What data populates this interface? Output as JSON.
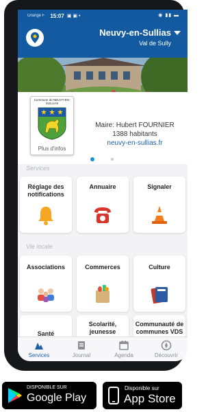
{
  "status": {
    "carrier": "Orange F",
    "time": "15:07",
    "icons": "▣ ▣ •",
    "right": "◉ ▮▮ ▬"
  },
  "header": {
    "title": "Neuvy-en-Sullias",
    "subtitle": "Val de Sully"
  },
  "crest": {
    "name": "Commune de NEUVY-EN-SULLIAS",
    "more_label": "Plus d'infos"
  },
  "info": {
    "mayor": "Maire: Hubert FOURNIER",
    "population": "1388 habitants",
    "website": "neuvy-en-sullias.fr"
  },
  "sections": {
    "services": "Services",
    "vie_locale": "Vie locale"
  },
  "tiles": [
    {
      "label": "Réglage des notifications",
      "icon": "bell-icon"
    },
    {
      "label": "Annuaire",
      "icon": "phone-icon"
    },
    {
      "label": "Signaler",
      "icon": "traffic-cone-icon"
    },
    {
      "label": "Associations",
      "icon": "people-icon"
    },
    {
      "label": "Commerces",
      "icon": "shopping-bag-icon"
    },
    {
      "label": "Culture",
      "icon": "books-icon"
    },
    {
      "label": "Santé",
      "icon": "health-icon"
    },
    {
      "label": "Scolarité, jeunesse",
      "icon": "school-icon"
    },
    {
      "label": "Communauté de communes VDS",
      "icon": "community-icon"
    }
  ],
  "tabs": [
    {
      "label": "Services",
      "icon": "services-icon",
      "active": true
    },
    {
      "label": "Journal",
      "icon": "journal-icon",
      "active": false
    },
    {
      "label": "Agenda",
      "icon": "calendar-icon",
      "active": false
    },
    {
      "label": "Découvrir",
      "icon": "compass-icon",
      "active": false
    }
  ],
  "stores": {
    "google": {
      "top": "DISPONIBLE SUR",
      "name": "Google Play"
    },
    "apple": {
      "top": "Disponible sur",
      "name": "App Store"
    }
  },
  "colors": {
    "brand": "#135aa1",
    "link": "#1d5fa6",
    "tile_bg": "#ffffff",
    "screen_bg": "#f3f3f6"
  }
}
